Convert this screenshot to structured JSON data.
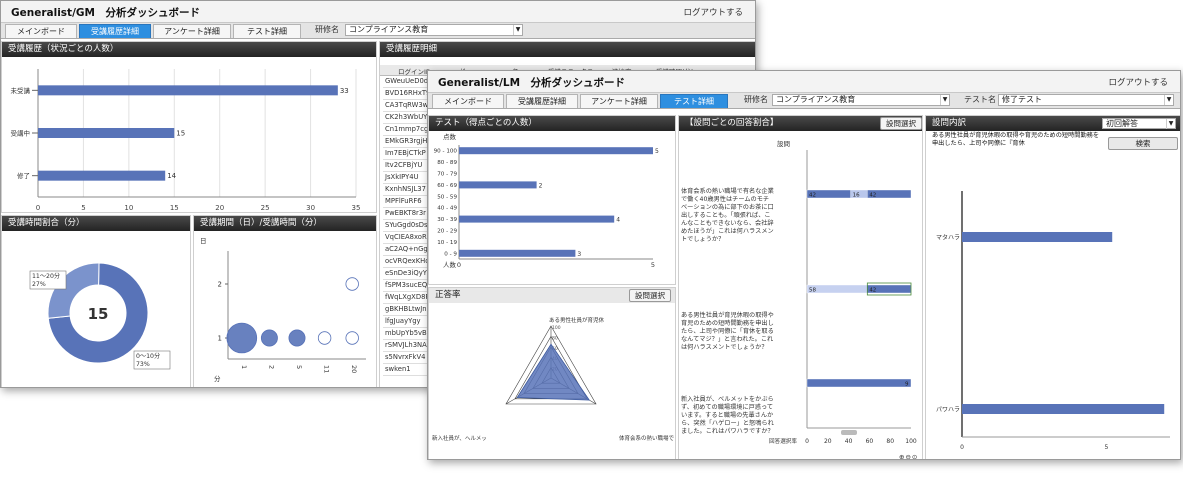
{
  "win1": {
    "title": "Generalist/GM　分析ダッシュボード",
    "logout": "ログアウトする",
    "tabs": [
      "メインボード",
      "受講履歴詳細",
      "アンケート詳細",
      "テスト詳細"
    ],
    "active_tab": 1,
    "course_label": "研修名",
    "course_value": "コンプライアンス教育",
    "panel_status_title": "受講履歴（状況ごとの人数）",
    "panel_detail_title": "受講履歴明細",
    "panel_ratio_title": "受講時間割合（分）",
    "panel_period_title": "受講期間（日）/受講時間（分）",
    "detail_headers": [
      "ログインID",
      "姓",
      "名",
      "受講ステータス",
      "進捗率",
      "受講時間(分)"
    ],
    "login_ids": [
      "GWeuUeD0dS",
      "BVD16RHxT9",
      "CA3TqRW3wm",
      "CK2h3WbUY",
      "Cn1mmp7cgX",
      "EMkGR3rgjH",
      "Im7EBjCTkP",
      "Itv2CFBjYU",
      "JsXkIPY4U",
      "KxnhNSJL37",
      "MPFlFuRF6",
      "PwEBKT8r3r",
      "SYuGgd0sDs",
      "VqCIEA8xoR",
      "aC2AQ+nGgIz",
      "ocVRQexKHq",
      "eSnDe3iQyY",
      "fSPM3sucEQ",
      "fWqLXgXD8P",
      "gBKHBLtwJn",
      "lfgJuayYgy",
      "mbUpYb5vB",
      "rSMVJLh3NA",
      "s5NvrxFkV4",
      "swken1"
    ]
  },
  "win2": {
    "title": "Generalist/LM　分析ダッシュボード",
    "logout": "ログアウトする",
    "tabs": [
      "メインボード",
      "受講履歴詳細",
      "アンケート詳細",
      "テスト詳細"
    ],
    "active_tab": 3,
    "course_label": "研修名",
    "course_value": "コンプライアンス教育",
    "test_label": "テスト名",
    "test_value": "修了テスト",
    "panel_score_title": "テスト（得点ごとの人数）",
    "panel_answer_title": "【設問ごとの回答割合】",
    "question_select_button": "設問選択",
    "panel_content_title": "設問内訳",
    "content_dropdown": "初回解答",
    "search_button": "検索",
    "panel_accuracy_title": "正答率",
    "accuracy_button": "設問選択",
    "setsumon_label": "設問",
    "answer_rate_label": "回答選択率",
    "content_text": "ある男性社員が育児休暇の取得や育児のための短時間勤務を申出したら、上司や同僚に『育休",
    "questions": [
      "体育会系の熱い職場で有名な企業で働く40歳男性はチームのモチベーションの為に部下のお茶に口出しすることも。「頑張れば、こんなこともできないなら、会社辞めたほうが」これは何ハラスメントでしょうか？",
      "ある男性社員が育児休暇の取得や育児のための短時間勤務を申出したら、上司や同僚に「育休を取るなんてマジ？」と言われた。これは何ハラスメントでしょうか？",
      "新入社員が、ベルメットをかぶらず、初めての職場環境に戸惑っています。すると職場の先輩さんから、突然「ハゲロー」と怒鳴られました。これはパワハラですか？"
    ],
    "radar_labels": [
      "ある男性社員が育児休",
      "体育会系の熱い職場で",
      "新入社員が、ヘルメッ"
    ]
  },
  "chart_data": [
    {
      "type": "bar",
      "orientation": "horizontal",
      "title": "受講履歴（状況ごとの人数）",
      "categories": [
        "未受講",
        "受講中",
        "修了"
      ],
      "values": [
        33,
        15,
        14
      ],
      "xlim": [
        0,
        35
      ],
      "xticks": [
        0,
        5,
        10,
        15,
        20,
        25,
        30,
        35
      ],
      "grid": true
    },
    {
      "type": "pie",
      "title": "受講時間割合（分）",
      "center_label": "15",
      "slices": [
        {
          "label": "0〜10分",
          "percent": 73,
          "color": "#5873b8"
        },
        {
          "label": "11〜20分",
          "percent": 27,
          "color": "#7b93cc"
        }
      ]
    },
    {
      "type": "scatter",
      "title": "受講期間（日）/受講時間（分）",
      "ylabel": "日",
      "xlabel": "分",
      "xcategories": [
        "1",
        "2",
        "5",
        "11",
        "20"
      ],
      "yticks": [
        1,
        2
      ],
      "points": [
        {
          "x": "1",
          "y": 1,
          "size": 9
        },
        {
          "x": "2",
          "y": 1,
          "size": 2
        },
        {
          "x": "5",
          "y": 1,
          "size": 2
        },
        {
          "x": "11",
          "y": 1,
          "size": 1
        },
        {
          "x": "20",
          "y": 1,
          "size": 1
        },
        {
          "x": "20",
          "y": 2,
          "size": 1
        }
      ]
    },
    {
      "type": "bar",
      "orientation": "horizontal",
      "title": "テスト（得点ごとの人数）",
      "ylabel": "点数",
      "xlabel": "人数",
      "categories": [
        "90 - 100",
        "80 - 89",
        "70 - 79",
        "60 - 69",
        "50 - 59",
        "40 - 49",
        "30 - 39",
        "20 - 29",
        "10 - 19",
        "0 - 9"
      ],
      "values": [
        5,
        0,
        0,
        2,
        0,
        0,
        4,
        0,
        0,
        3
      ],
      "xlim": [
        0,
        5
      ],
      "xticks": [
        0,
        5
      ]
    },
    {
      "type": "bar",
      "orientation": "horizontal",
      "stacked": true,
      "title": "【設問ごとの回答割合】",
      "xlabel": "回答選択率",
      "xlim": [
        0,
        100
      ],
      "xticks": [
        0,
        20,
        40,
        60,
        80,
        100
      ],
      "rows": [
        {
          "segments": [
            42,
            16,
            42
          ],
          "labels": [
            "42",
            "16",
            "42"
          ]
        },
        {
          "segments": [
            58,
            42
          ],
          "labels": [
            "58",
            "42"
          ]
        },
        {
          "segments": [
            100
          ],
          "labels": [
            "9"
          ]
        }
      ]
    },
    {
      "type": "radar",
      "title": "正答率",
      "axes": [
        "ある男性社員が育児休",
        "体育会系の熱い職場で",
        "新入社員が、ヘルメッ"
      ],
      "values": [
        65,
        85,
        75
      ],
      "rlim": [
        0,
        100
      ],
      "rticks": [
        20,
        40,
        60,
        80,
        100
      ]
    },
    {
      "type": "bar",
      "orientation": "horizontal",
      "title": "設問内訳",
      "categories": [
        "マタハラ",
        "パワハラ"
      ],
      "values": [
        5.2,
        7.0
      ],
      "xlim": [
        0,
        7.2
      ],
      "xticks": [
        0,
        5
      ]
    }
  ]
}
